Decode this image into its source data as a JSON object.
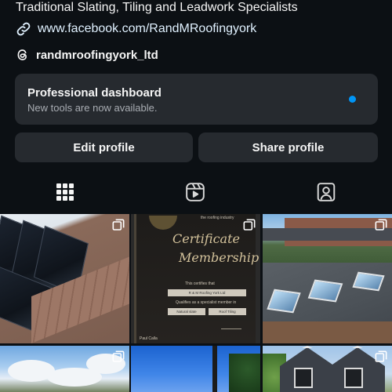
{
  "profile": {
    "tagline": "Traditional Slating, Tiling and Leadwork Specialists",
    "link": "www.facebook.com/RandMRoofingyork",
    "threads_handle": "randmroofingyork_ltd"
  },
  "dashboard": {
    "title": "Professional dashboard",
    "subtitle": "New tools are now available.",
    "dot_color": "#0095f6"
  },
  "buttons": {
    "edit": "Edit profile",
    "share": "Share profile"
  },
  "tabs": [
    {
      "name": "posts-grid",
      "icon": "grid-icon",
      "active": true
    },
    {
      "name": "reels",
      "icon": "reels-icon",
      "active": false
    },
    {
      "name": "tagged",
      "icon": "tagged-person-icon",
      "active": false
    }
  ],
  "posts": [
    {
      "subject": "solar-panels-roof",
      "multi": true
    },
    {
      "subject": "certificate",
      "multi": true
    },
    {
      "subject": "house-skylights",
      "multi": true
    },
    {
      "subject": "clouds-sky",
      "multi": true
    },
    {
      "subject": "blue-sky-pole",
      "multi": false
    },
    {
      "subject": "house-gables",
      "multi": true
    }
  ],
  "certificate": {
    "header": "the roofing industry",
    "script_1": "Certificate",
    "script_2": "Membership",
    "certifies": "This certifies that",
    "company": "R & M Roofing York Ltd",
    "qualifies": "Qualifies as a specialist member in",
    "field_1": "Natural slate",
    "field_2": "Roof Tiling",
    "footer_left": "Paul Calla"
  },
  "colors": {
    "background": "#0c1014",
    "card": "#262a2f",
    "text": "#f5f5f5",
    "link": "#e0f1ff",
    "muted": "#a8acb2"
  }
}
